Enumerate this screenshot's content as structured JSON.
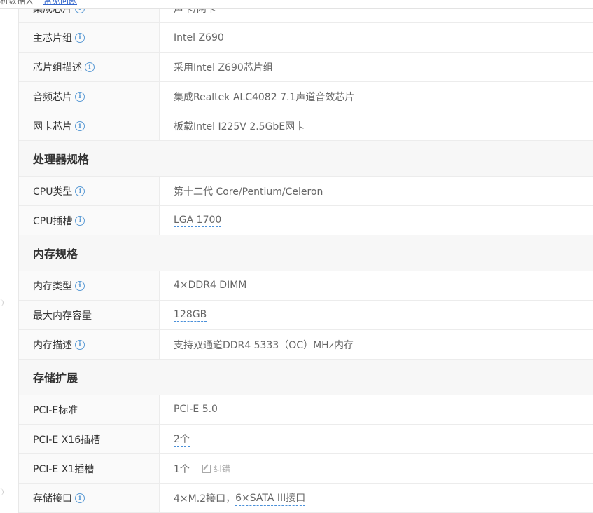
{
  "top_strip": {
    "crumb1": "机数据大",
    "crumb2": "常见问题"
  },
  "rows_top": [
    {
      "label": "集成芯片",
      "info": true,
      "value": "声卡/网卡",
      "link": false
    },
    {
      "label": "主芯片组",
      "info": true,
      "value": "Intel Z690",
      "link": false
    },
    {
      "label": "芯片组描述",
      "info": true,
      "value": "采用Intel Z690芯片组",
      "link": false
    },
    {
      "label": "音频芯片",
      "info": true,
      "value": "集成Realtek ALC4082 7.1声道音效芯片",
      "link": false
    },
    {
      "label": "网卡芯片",
      "info": true,
      "value": "板载Intel I225V 2.5GbE网卡",
      "link": false
    }
  ],
  "section_cpu": "处理器规格",
  "rows_cpu": [
    {
      "label": "CPU类型",
      "info": true,
      "value": "第十二代 Core/Pentium/Celeron",
      "link": false
    },
    {
      "label": "CPU插槽",
      "info": true,
      "value": "LGA 1700",
      "link": true
    }
  ],
  "section_mem": "内存规格",
  "rows_mem": [
    {
      "label": "内存类型",
      "info": true,
      "value": "4×DDR4 DIMM",
      "link": true
    },
    {
      "label": "最大内存容量",
      "info": false,
      "value": "128GB",
      "link": true
    },
    {
      "label": "内存描述",
      "info": true,
      "value": "支持双通道DDR4 5333（OC）MHz内存",
      "link": false
    }
  ],
  "section_storage": "存储扩展",
  "rows_storage": [
    {
      "label": "PCI-E标准",
      "info": false,
      "value": "PCI-E 5.0",
      "link": true
    },
    {
      "label": "PCI-E X16插槽",
      "info": false,
      "value": "2个",
      "link": true
    },
    {
      "label": "PCI-E X1插槽",
      "info": false,
      "value": "1个",
      "link": false,
      "edit": "纠错"
    },
    {
      "label": "存储接口",
      "info": true,
      "value_part1": "4×M.2接口",
      "value_sep": "，",
      "value_part2": "6×SATA III接口"
    }
  ],
  "info_glyph": "i",
  "colors": {
    "info": "#5b9bd5",
    "link_underline": "#4a90d9",
    "section_bg": "#f7f7f7"
  }
}
